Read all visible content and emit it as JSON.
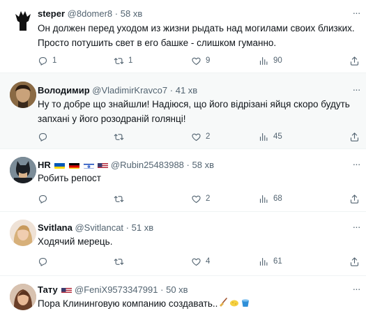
{
  "tweets": [
    {
      "name": "steper",
      "handle": "@8domer8",
      "sep": "·",
      "time": "58 хв",
      "text": "Он должен перед уходом из жизни рыдать над могилами своих близких.\nПросто потушить свет в его башке - слишком гуманно.",
      "replies": "1",
      "reposts": "1",
      "likes": "9",
      "views": "90"
    },
    {
      "name": "Володимир",
      "handle": "@VladimirKravco7",
      "sep": "·",
      "time": "41 хв",
      "text": "Ну то добре що знайшли! Надіюся, що його відрізані яйця скоро будуть\nзапхані у його розодраній голянці!",
      "replies": "",
      "reposts": "",
      "likes": "2",
      "views": "45"
    },
    {
      "name": "HR",
      "handle": "@Rubin25483988",
      "sep": "·",
      "time": "58 хв",
      "text": "Робить репост",
      "replies": "",
      "reposts": "",
      "likes": "2",
      "views": "68"
    },
    {
      "name": "Svitlana",
      "handle": "@Svitlancat",
      "sep": "·",
      "time": "51 хв",
      "text": "Ходячий мерець.",
      "replies": "",
      "reposts": "",
      "likes": "4",
      "views": "61"
    },
    {
      "name": "Тату",
      "handle": "@FeniX9573347991",
      "sep": "·",
      "time": "50 хв",
      "text": "Пора Клининговую компанию создавать..",
      "replies": "",
      "reposts": "",
      "likes": "",
      "views": ""
    }
  ],
  "icons": {
    "reply": "reply-icon",
    "repost": "repost-icon",
    "like": "heart-icon",
    "views": "views-chart-icon",
    "share": "share-icon",
    "more": "more-dots-icon"
  },
  "colors": {
    "text_primary": "#0f1419",
    "text_secondary": "#536471",
    "divider": "#eff3f4",
    "highlight_bg": "#f7f9f9"
  }
}
